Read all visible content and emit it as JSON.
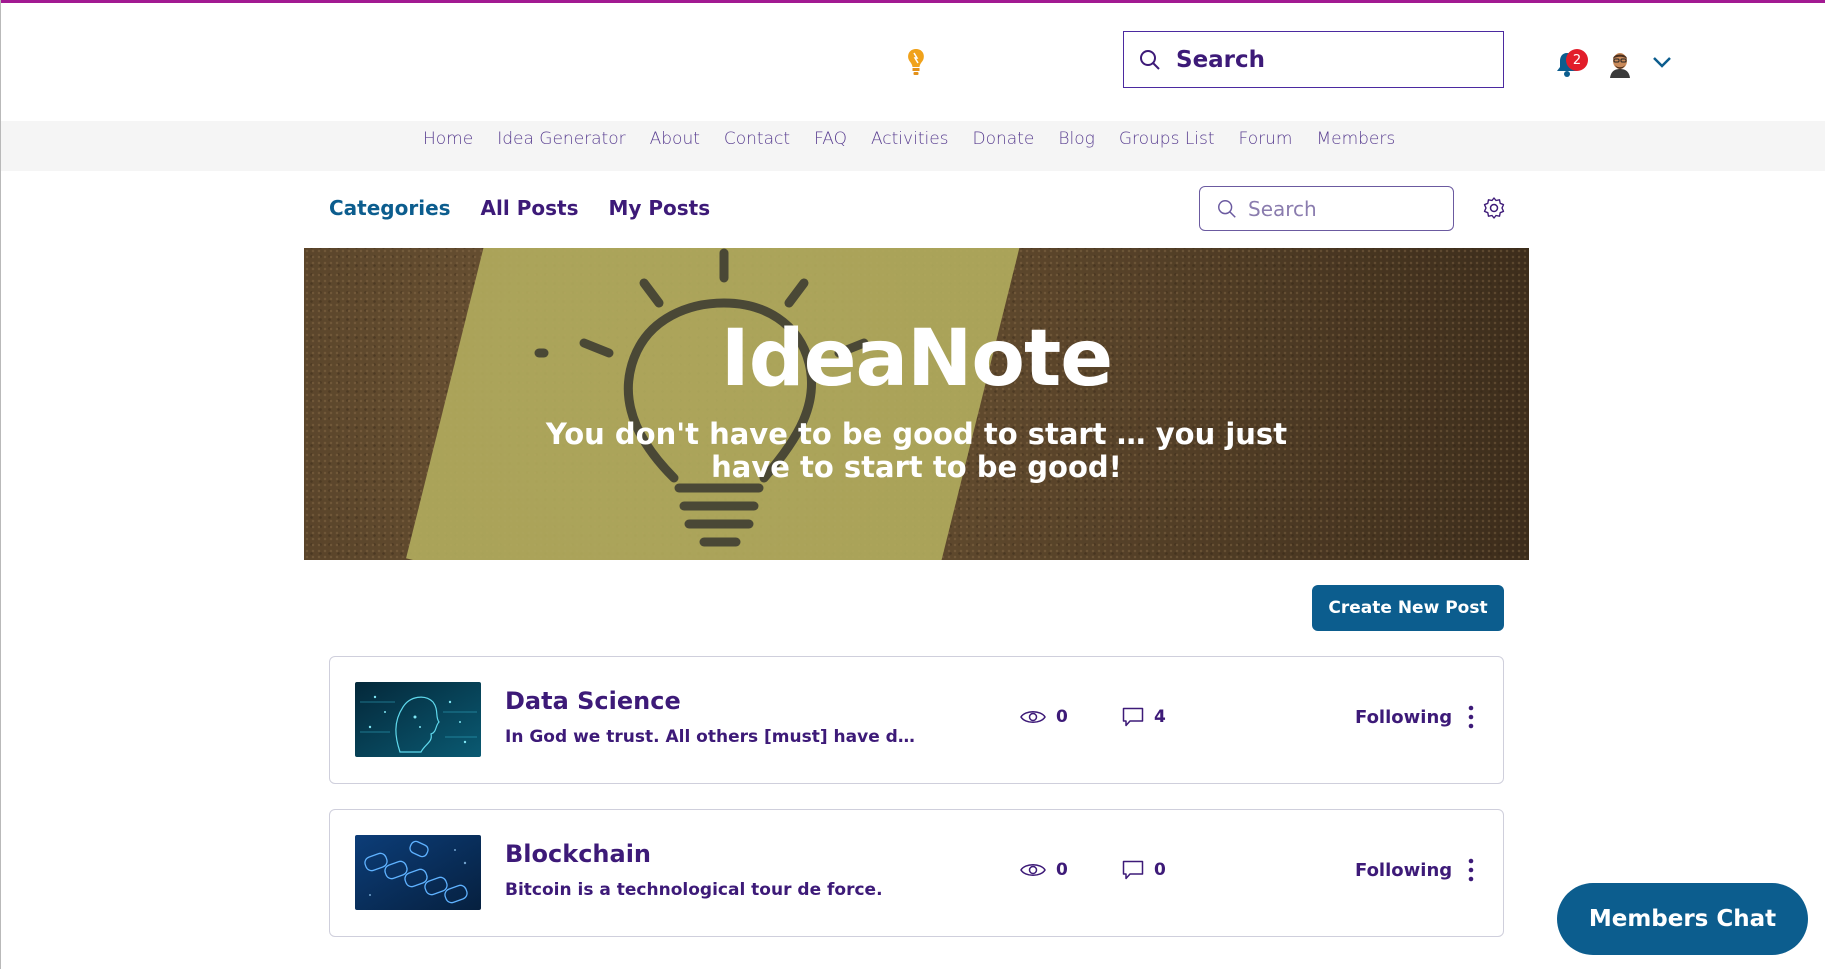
{
  "header": {
    "search_placeholder": "Search",
    "notification_count": "2"
  },
  "nav": {
    "items": [
      "Home",
      "Idea Generator",
      "About",
      "Contact",
      "FAQ",
      "Activities",
      "Donate",
      "Blog",
      "Groups List",
      "Forum",
      "Members"
    ]
  },
  "forum": {
    "tabs": [
      "Categories",
      "All Posts",
      "My Posts"
    ],
    "active_tab": "Categories",
    "search_placeholder": "Search"
  },
  "hero": {
    "title": "IdeaNote",
    "subtitle": "You don't have to be good to start … you just have to start to be good!"
  },
  "create_button": "Create New Post",
  "categories": [
    {
      "title": "Data Science",
      "description": "In God we trust. All others [must] have da...",
      "views": "0",
      "comments": "4",
      "follow_label": "Following"
    },
    {
      "title": "Blockchain",
      "description": "Bitcoin is a technological tour de force.",
      "views": "0",
      "comments": "0",
      "follow_label": "Following"
    }
  ],
  "chat_button": "Members Chat",
  "colors": {
    "primary": "#0c5d8e",
    "text": "#3d1a78",
    "accent_line": "#a21a92",
    "badge": "#e21d2a"
  },
  "icons": {
    "logo": "lightbulb-icon",
    "search": "search-icon",
    "notifications": "bell-icon",
    "account": "avatar",
    "menu": "chevron-down-icon",
    "settings": "gear-icon",
    "views": "eye-icon",
    "comments": "comment-icon",
    "more": "more-vertical-icon"
  }
}
